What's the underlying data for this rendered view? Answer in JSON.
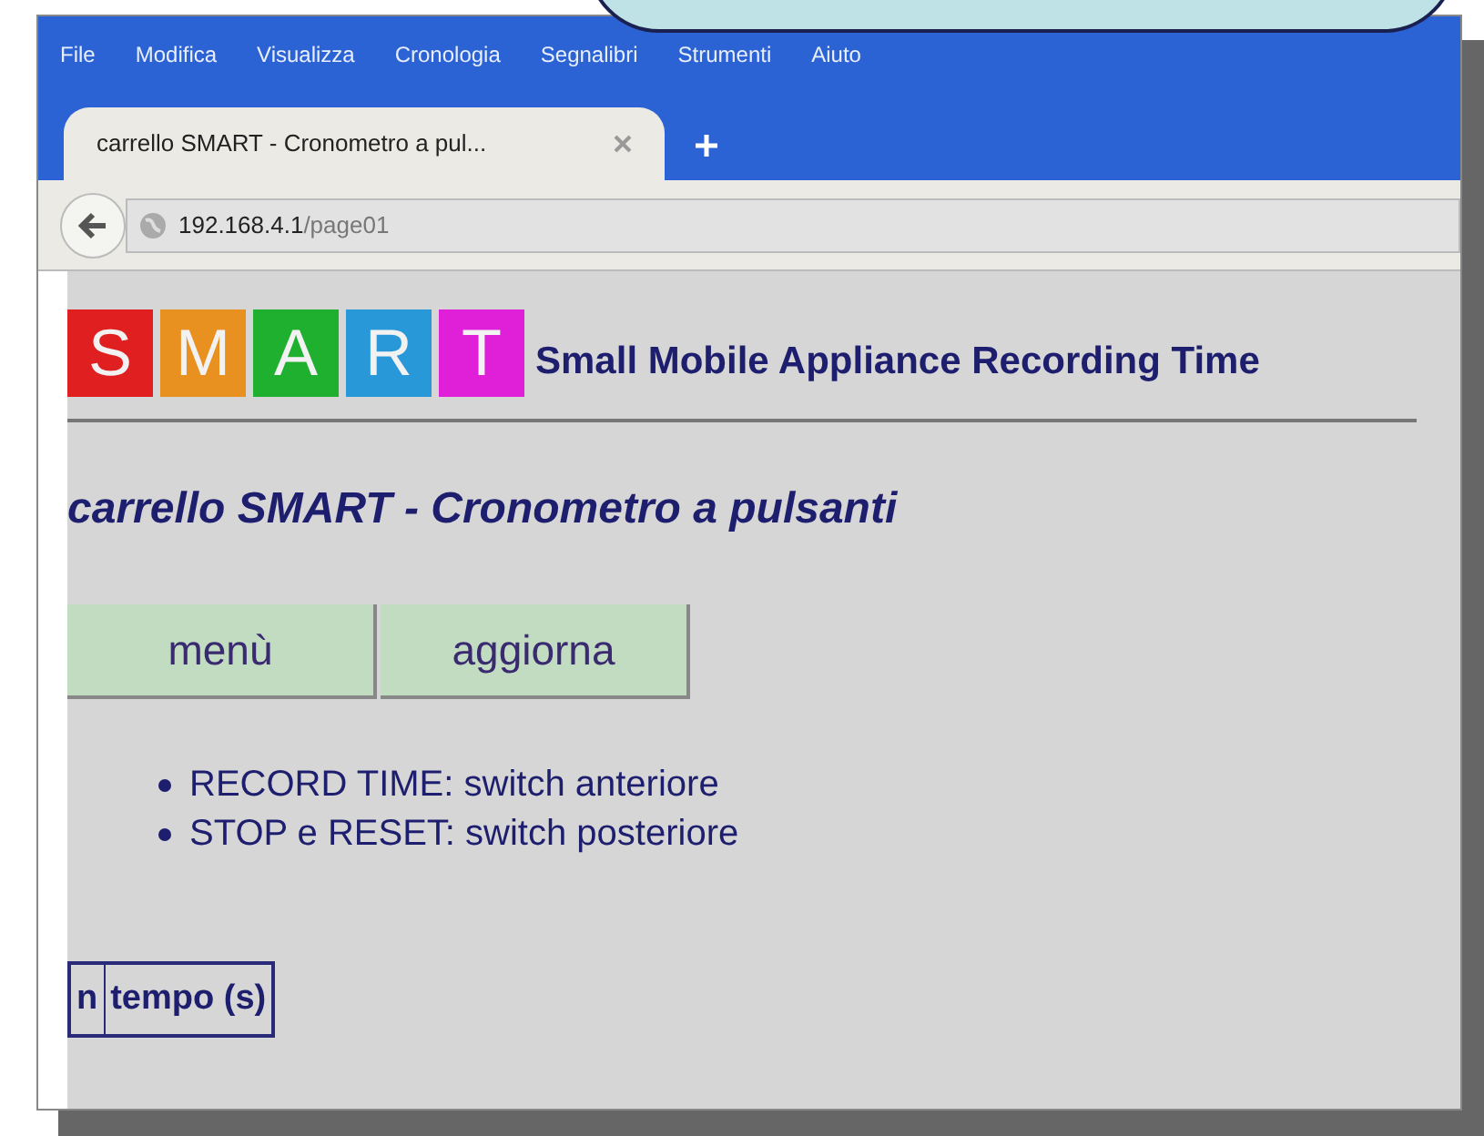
{
  "menu_bar": [
    "File",
    "Modifica",
    "Visualizza",
    "Cronologia",
    "Segnalibri",
    "Strumenti",
    "Aiuto"
  ],
  "tabs": [
    {
      "label": "carrello SMART - Cronometro a pul...",
      "selected": true
    }
  ],
  "address_bar": {
    "host": "192.168.4.1",
    "path": "/page01"
  },
  "logo": {
    "letters": [
      {
        "text": "S",
        "color": "#e02020"
      },
      {
        "text": "M",
        "color": "#e89020"
      },
      {
        "text": "A",
        "color": "#20b030"
      },
      {
        "text": "R",
        "color": "#2898d8"
      },
      {
        "text": "T",
        "color": "#e020d8"
      }
    ],
    "tagline": "Small Mobile Appliance Recording Time"
  },
  "page_title": "carrello SMART - Cronometro a pulsanti",
  "buttons": [
    "menù",
    "aggiorna"
  ],
  "instructions": [
    "RECORD TIME: switch anteriore",
    "STOP e RESET: switch posteriore"
  ],
  "table": {
    "columns": [
      "n",
      "tempo (s)"
    ]
  }
}
